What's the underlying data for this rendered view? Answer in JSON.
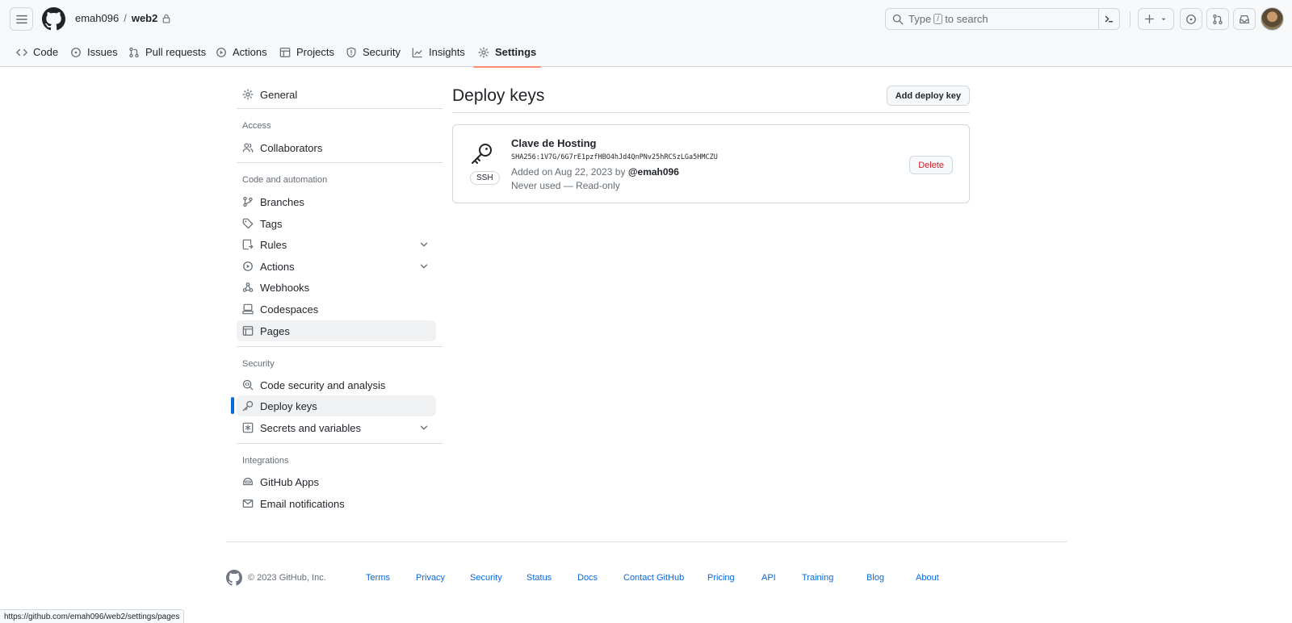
{
  "header": {
    "owner": "emah096",
    "separator": "/",
    "repo": "web2",
    "search_prefix": "Type",
    "search_key": "/",
    "search_suffix": "to search"
  },
  "tabs": [
    {
      "label": "Code",
      "icon": "code-icon"
    },
    {
      "label": "Issues",
      "icon": "issue-icon"
    },
    {
      "label": "Pull requests",
      "icon": "pull-request-icon"
    },
    {
      "label": "Actions",
      "icon": "play-icon"
    },
    {
      "label": "Projects",
      "icon": "table-icon"
    },
    {
      "label": "Security",
      "icon": "shield-icon"
    },
    {
      "label": "Insights",
      "icon": "graph-icon"
    },
    {
      "label": "Settings",
      "icon": "gear-icon",
      "selected": true
    }
  ],
  "sidebar": {
    "general": "General",
    "access_heading": "Access",
    "collaborators": "Collaborators",
    "code_heading": "Code and automation",
    "branches": "Branches",
    "tags": "Tags",
    "rules": "Rules",
    "actions": "Actions",
    "webhooks": "Webhooks",
    "codespaces": "Codespaces",
    "pages": "Pages",
    "security_heading": "Security",
    "code_security": "Code security and analysis",
    "deploy_keys": "Deploy keys",
    "secrets": "Secrets and variables",
    "integrations_heading": "Integrations",
    "github_apps": "GitHub Apps",
    "email_notifications": "Email notifications"
  },
  "main": {
    "title": "Deploy keys",
    "add_button": "Add deploy key",
    "key": {
      "name": "Clave de Hosting",
      "badge": "SSH",
      "fingerprint": "SHA256:1V7G/6G7rE1pzfHBO4hJd4QnPNv25hRCSzLGa5HMCZU",
      "added_text": "Added on Aug 22, 2023 by",
      "added_by": "@emah096",
      "usage": "Never used — Read-only",
      "delete_button": "Delete"
    }
  },
  "footer": {
    "copyright": "© 2023 GitHub, Inc.",
    "links": [
      "Terms",
      "Privacy",
      "Security",
      "Status",
      "Docs",
      "Contact GitHub",
      "Pricing",
      "API",
      "Training",
      "Blog",
      "About"
    ]
  },
  "status_bar": {
    "url": "https://github.com/emah096/web2/settings/pages"
  },
  "colors": {
    "accent": "#0969da",
    "tab_underline": "#fd8c73",
    "danger": "#cf222e"
  }
}
